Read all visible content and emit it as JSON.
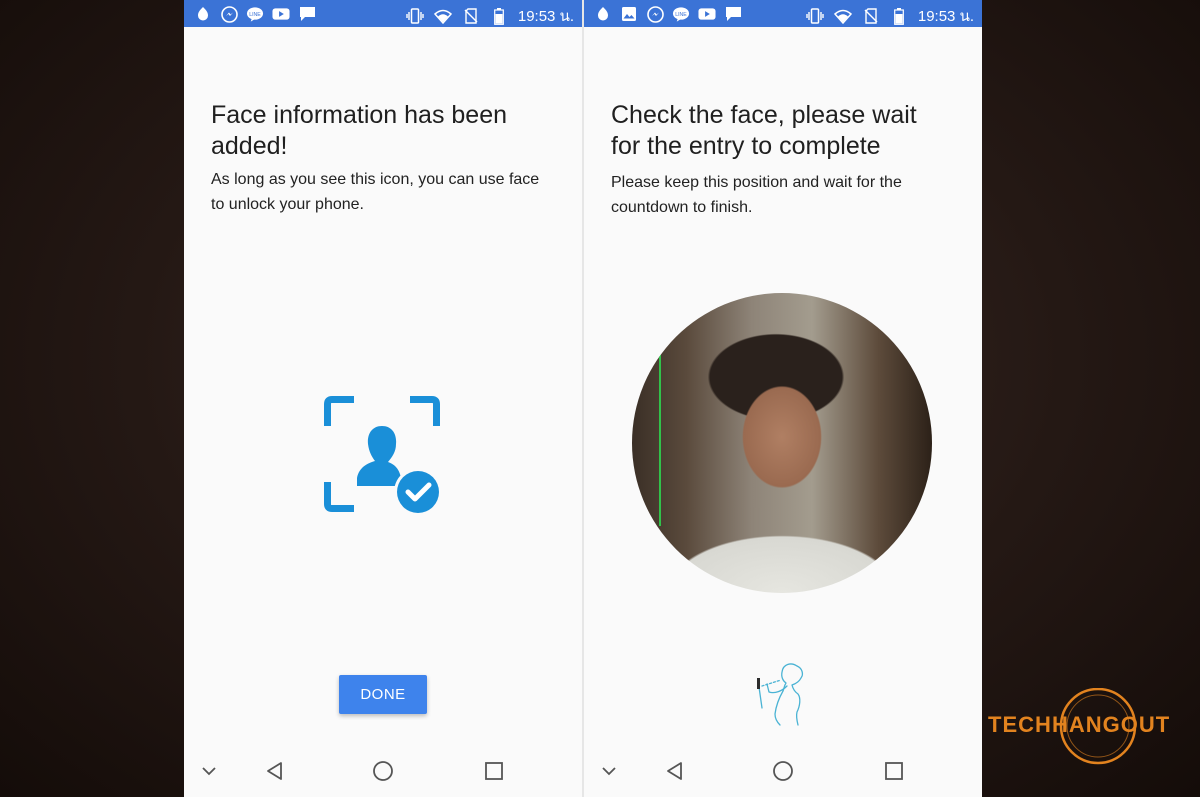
{
  "status_bar": {
    "time": "19:53 น.",
    "left_icons_left_phone": [
      "notification-app-icon",
      "messenger-icon",
      "line-icon",
      "youtube-icon",
      "message-icon"
    ],
    "left_icons_right_phone": [
      "notification-app-icon",
      "gallery-icon",
      "messenger-icon",
      "line-icon",
      "youtube-icon",
      "message-icon"
    ],
    "right_icons": [
      "vibrate-icon",
      "wifi-icon",
      "no-sim-icon",
      "battery-icon"
    ]
  },
  "left_screen": {
    "title": "Face information has been added!",
    "subtitle": "As long as you see this icon, you can use face to unlock your phone.",
    "done_label": "DONE",
    "icon": "face-recognized-icon",
    "accent_color": "#1a8fd8"
  },
  "right_screen": {
    "title": "Check the face, please wait for the entry to complete",
    "subtitle": "Please keep this position and wait for the countdown to finish.",
    "camera_preview": "face-camera-preview",
    "hint_icon": "hold-phone-hint-icon"
  },
  "nav_bar": [
    "collapse-icon",
    "back-icon",
    "home-icon",
    "recents-icon"
  ],
  "watermark": {
    "brand_left": "TECH",
    "brand_right": "HANGOUT",
    "color": "#e2831f"
  }
}
